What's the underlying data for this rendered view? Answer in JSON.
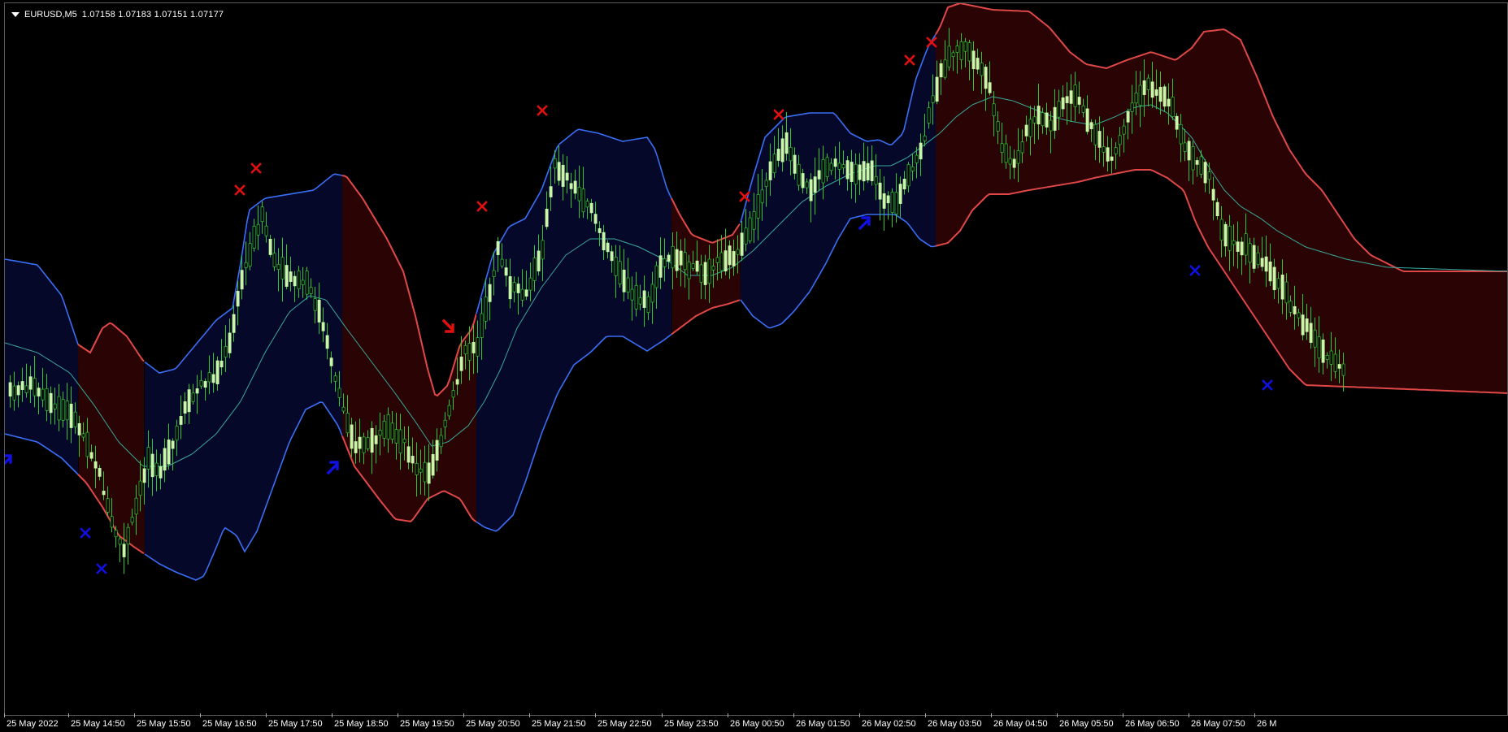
{
  "header": {
    "symbol": "EURUSD,M5",
    "prices": "1.07158 1.07183 1.07151 1.07177"
  },
  "time_axis": {
    "ticks": [
      "25 May 2022",
      "25 May 14:50",
      "25 May 15:50",
      "25 May 16:50",
      "25 May 17:50",
      "25 May 18:50",
      "25 May 19:50",
      "25 May 20:50",
      "25 May 21:50",
      "25 May 22:50",
      "25 May 23:50",
      "26 May 00:50",
      "26 May 01:50",
      "26 May 02:50",
      "26 May 03:50",
      "26 May 04:50",
      "26 May 05:50",
      "26 May 06:50",
      "26 May 07:50",
      "26 M"
    ]
  },
  "colors": {
    "background": "#000000",
    "candle": "#c8f7a8",
    "wick": "#32c832",
    "band_up_fill": "#2a0404",
    "band_down_fill": "#050828",
    "band_up_line": "#e04848",
    "band_down_line": "#3a6ef5",
    "middle_line": "#3aa89a",
    "sell_marker": "#e01010",
    "buy_marker": "#1010e0"
  },
  "icons": {
    "collapse": "triangle-down-icon",
    "sell_signal": "red-x-icon",
    "buy_signal": "blue-x-icon",
    "buy_arrow": "blue-arrow-up-icon",
    "sell_arrow": "red-arrow-down-icon"
  }
}
